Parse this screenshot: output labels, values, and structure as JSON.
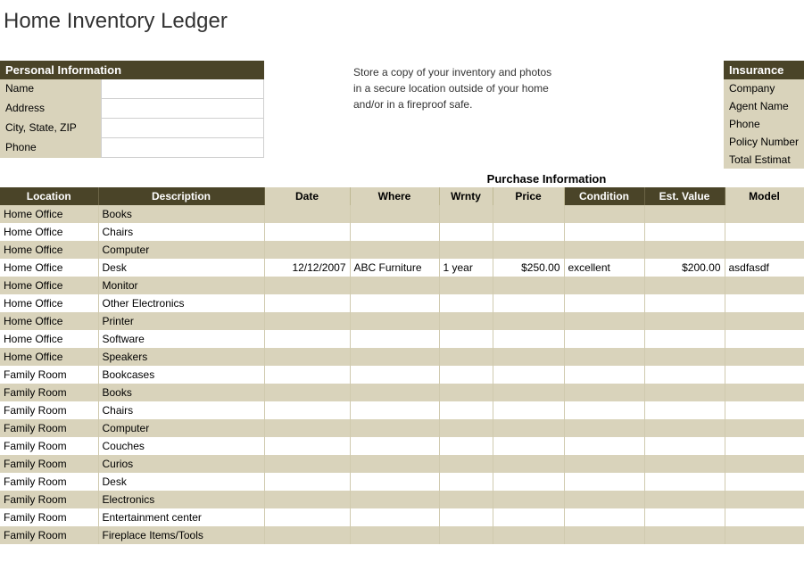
{
  "title": "Home Inventory Ledger",
  "personal": {
    "header": "Personal Information",
    "labels": {
      "name": "Name",
      "address": "Address",
      "csz": "City, State, ZIP",
      "phone": "Phone"
    },
    "values": {
      "name": "",
      "address": "",
      "csz": "",
      "phone": ""
    }
  },
  "note": {
    "l1": "Store a copy of your inventory and photos",
    "l2": "in a secure location outside of your home",
    "l3": "and/or in a fireproof safe."
  },
  "insurance": {
    "header": "Insurance",
    "labels": {
      "company": "Company",
      "agent": "Agent Name",
      "phone": "Phone",
      "policy": "Policy Number",
      "total": "Total Estimat"
    }
  },
  "purchase_section_title": "Purchase Information",
  "columns": {
    "location": "Location",
    "description": "Description",
    "date": "Date",
    "where": "Where",
    "wrnty": "Wrnty",
    "price": "Price",
    "condition": "Condition",
    "est_value": "Est. Value",
    "model": "Model"
  },
  "rows": [
    {
      "location": "Home Office",
      "description": "Books"
    },
    {
      "location": "Home Office",
      "description": "Chairs"
    },
    {
      "location": "Home Office",
      "description": "Computer"
    },
    {
      "location": "Home Office",
      "description": "Desk",
      "date": "12/12/2007",
      "where": "ABC Furniture",
      "wrnty": "1 year",
      "price": "$250.00",
      "condition": "excellent",
      "est_value": "$200.00",
      "model": "asdfasdf"
    },
    {
      "location": "Home Office",
      "description": "Monitor"
    },
    {
      "location": "Home Office",
      "description": "Other Electronics"
    },
    {
      "location": "Home Office",
      "description": "Printer"
    },
    {
      "location": "Home Office",
      "description": "Software"
    },
    {
      "location": "Home Office",
      "description": "Speakers"
    },
    {
      "location": "Family Room",
      "description": "Bookcases"
    },
    {
      "location": "Family Room",
      "description": "Books"
    },
    {
      "location": "Family Room",
      "description": "Chairs"
    },
    {
      "location": "Family Room",
      "description": "Computer"
    },
    {
      "location": "Family Room",
      "description": "Couches"
    },
    {
      "location": "Family Room",
      "description": "Curios"
    },
    {
      "location": "Family Room",
      "description": "Desk"
    },
    {
      "location": "Family Room",
      "description": "Electronics"
    },
    {
      "location": "Family Room",
      "description": "Entertainment center"
    },
    {
      "location": "Family Room",
      "description": "Fireplace Items/Tools"
    }
  ]
}
